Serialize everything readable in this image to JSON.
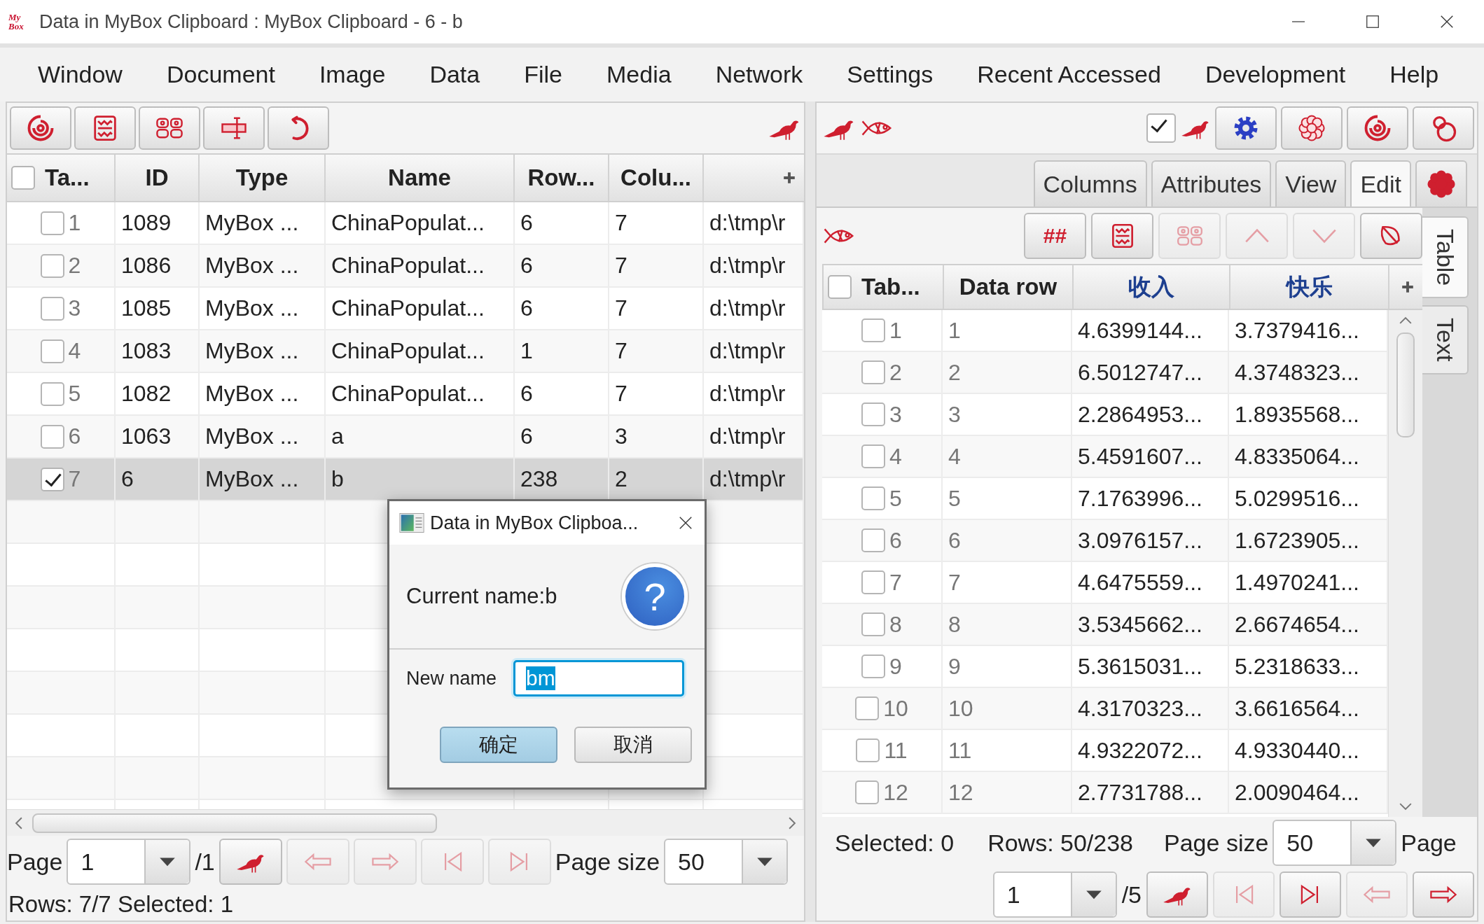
{
  "window": {
    "logo": "My Box",
    "title": "Data in MyBox Clipboard : MyBox Clipboard - 6 - b"
  },
  "menu": [
    "Window",
    "Document",
    "Image",
    "Data",
    "File",
    "Media",
    "Network",
    "Settings",
    "Recent Accessed",
    "Development",
    "Help"
  ],
  "left_panel": {
    "table": {
      "all_checked": false,
      "columns": [
        "Ta...",
        "ID",
        "Type",
        "Name",
        "Row...",
        "Colu..."
      ],
      "rows": [
        {
          "index": "1",
          "id": "1089",
          "type": "MyBox ...",
          "name": "ChinaPopulat...",
          "row_count": "6",
          "column_count": "7",
          "column_7": "d:\\tmp\\r",
          "checked": false,
          "selected": false
        },
        {
          "index": "2",
          "id": "1086",
          "type": "MyBox ...",
          "name": "ChinaPopulat...",
          "row_count": "6",
          "column_count": "7",
          "column_7": "d:\\tmp\\r",
          "checked": false,
          "selected": false
        },
        {
          "index": "3",
          "id": "1085",
          "type": "MyBox ...",
          "name": "ChinaPopulat...",
          "row_count": "6",
          "column_count": "7",
          "column_7": "d:\\tmp\\r",
          "checked": false,
          "selected": false
        },
        {
          "index": "4",
          "id": "1083",
          "type": "MyBox ...",
          "name": "ChinaPopulat...",
          "row_count": "1",
          "column_count": "7",
          "column_7": "d:\\tmp\\r",
          "checked": false,
          "selected": false
        },
        {
          "index": "5",
          "id": "1082",
          "type": "MyBox ...",
          "name": "ChinaPopulat...",
          "row_count": "6",
          "column_count": "7",
          "column_7": "d:\\tmp\\r",
          "checked": false,
          "selected": false
        },
        {
          "index": "6",
          "id": "1063",
          "type": "MyBox ...",
          "name": "a",
          "row_count": "6",
          "column_count": "3",
          "column_7": "d:\\tmp\\r",
          "checked": false,
          "selected": false
        },
        {
          "index": "7",
          "id": "6",
          "type": "MyBox ...",
          "name": "b",
          "row_count": "238",
          "column_count": "2",
          "column_7": "d:\\tmp\\r",
          "checked": true,
          "selected": true
        }
      ]
    },
    "pagination": {
      "page_label": "Page",
      "page": "1",
      "page_count": "/1",
      "page_size_label": "Page size",
      "page_size": "50",
      "buttons": [
        {
          "kind": "go",
          "disabled": false
        },
        {
          "kind": "previous",
          "disabled": true
        },
        {
          "kind": "next",
          "disabled": true
        },
        {
          "kind": "first",
          "disabled": true
        },
        {
          "kind": "last",
          "disabled": true
        }
      ]
    },
    "status": "Rows: 7/7 Selected: 1"
  },
  "right_panel": {
    "toolbar": {
      "checked": true
    },
    "tabs": [
      {
        "kind": "text",
        "label": "Columns",
        "selected": false
      },
      {
        "kind": "text",
        "label": "Attributes",
        "selected": false
      },
      {
        "kind": "text",
        "label": "View",
        "selected": false
      },
      {
        "kind": "text",
        "label": "Edit",
        "selected": true
      },
      {
        "kind": "icon",
        "selected": false
      }
    ],
    "edit_toolbar": [
      {
        "kind": "text",
        "label": "##",
        "disabled": false
      },
      {
        "kind": "icon",
        "disabled": false
      },
      {
        "kind": "icon",
        "disabled": true
      },
      {
        "kind": "icon",
        "disabled": true
      },
      {
        "kind": "icon",
        "disabled": true
      },
      {
        "kind": "icon",
        "disabled": false
      }
    ],
    "side_tabs": [
      {
        "label": "Table",
        "selected": true
      },
      {
        "label": "Text",
        "selected": false
      }
    ],
    "table": {
      "all_checked": false,
      "columns": [
        {
          "label": "Tab...",
          "kind": "system"
        },
        {
          "label": "Data row",
          "kind": "system"
        },
        {
          "label": "收入",
          "kind": "data"
        },
        {
          "label": "快乐",
          "kind": "data"
        }
      ],
      "rows": [
        {
          "index": "1",
          "data_row": "1",
          "values": [
            "4.6399144...",
            "3.7379416..."
          ],
          "checked": false
        },
        {
          "index": "2",
          "data_row": "2",
          "values": [
            "6.5012747...",
            "4.3748323..."
          ],
          "checked": false
        },
        {
          "index": "3",
          "data_row": "3",
          "values": [
            "2.2864953...",
            "1.8935568..."
          ],
          "checked": false
        },
        {
          "index": "4",
          "data_row": "4",
          "values": [
            "5.4591607...",
            "4.8335064..."
          ],
          "checked": false
        },
        {
          "index": "5",
          "data_row": "5",
          "values": [
            "7.1763996...",
            "5.0299516..."
          ],
          "checked": false
        },
        {
          "index": "6",
          "data_row": "6",
          "values": [
            "3.0976157...",
            "1.6723905..."
          ],
          "checked": false
        },
        {
          "index": "7",
          "data_row": "7",
          "values": [
            "4.6475559...",
            "1.4970241..."
          ],
          "checked": false
        },
        {
          "index": "8",
          "data_row": "8",
          "values": [
            "3.5345662...",
            "2.6674654..."
          ],
          "checked": false
        },
        {
          "index": "9",
          "data_row": "9",
          "values": [
            "5.3615031...",
            "5.2318633..."
          ],
          "checked": false
        },
        {
          "index": "10",
          "data_row": "10",
          "values": [
            "4.3170323...",
            "3.6616564..."
          ],
          "checked": false
        },
        {
          "index": "11",
          "data_row": "11",
          "values": [
            "4.9322072...",
            "4.9330440..."
          ],
          "checked": false
        },
        {
          "index": "12",
          "data_row": "12",
          "values": [
            "2.7731788...",
            "2.0090464..."
          ],
          "checked": false
        }
      ]
    },
    "status": {
      "selected": "Selected: 0",
      "rows": "Rows: 50/238",
      "page_size_label": "Page size",
      "page_size": "50",
      "page_label": "Page",
      "page": "1",
      "page_count": "/5",
      "buttons": [
        {
          "kind": "go",
          "disabled": false
        },
        {
          "kind": "first",
          "disabled": true
        },
        {
          "kind": "last",
          "disabled": false
        },
        {
          "kind": "previous",
          "disabled": true
        },
        {
          "kind": "next",
          "disabled": false
        }
      ]
    }
  },
  "dialog": {
    "title": "Data in MyBox Clipboa...",
    "message": "Current name:b",
    "icon_glyph": "?",
    "field_label": "New name",
    "value": "bm",
    "buttons": [
      {
        "label": "确定",
        "default": true
      },
      {
        "label": "取消",
        "default": false
      }
    ]
  }
}
